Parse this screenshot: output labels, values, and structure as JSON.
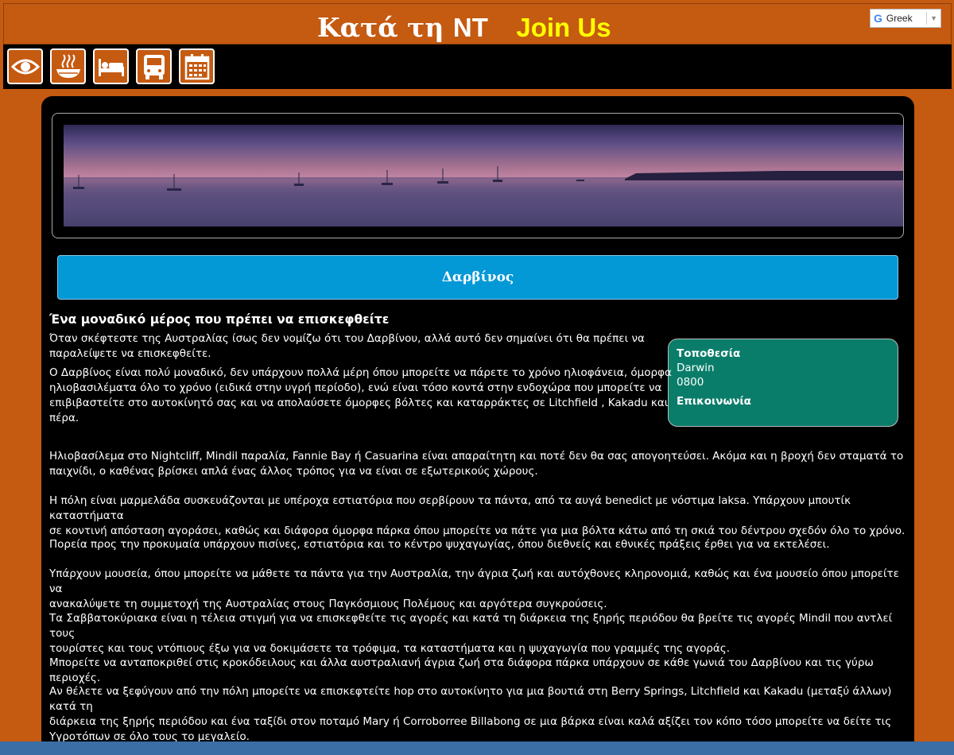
{
  "header": {
    "title_greek": "Κατά τη",
    "title_nt": "NT",
    "join_label": "Join Us"
  },
  "translate_widget": {
    "brand": "G",
    "language": "Greek",
    "arrow": "▼"
  },
  "nav_icons": [
    "eye-icon",
    "food-icon",
    "bed-icon",
    "bus-icon",
    "calendar-icon"
  ],
  "colors": {
    "header_bg": "#c55a11",
    "content_bg": "#000000",
    "city_bar": "#0398d6",
    "info_box": "#0a7d6a",
    "join_text": "#ffff00"
  },
  "page": {
    "city": "Δαρβίνος",
    "heading": "Ένα μοναδικό μέρος που πρέπει να επισκεφθείτε",
    "info": {
      "location_label": "Τοποθεσία",
      "location_city": "Darwin",
      "location_code": "0800",
      "contact_label": "Επικοινωνία"
    },
    "paragraphs": [
      [
        "Όταν σκέφτεστε της Αυστραλίας ίσως δεν νομίζω ότι του Δαρβίνου, αλλά αυτό δεν σημαίνει ότι θα πρέπει να",
        "παραλείψετε να επισκεφθείτε."
      ],
      [
        "Ο Δαρβίνος είναι πολύ μοναδικό, δεν υπάρχουν πολλά μέρη όπου μπορείτε να πάρετε το χρόνο ηλιοφάνεια, όμορφα",
        "ηλιοβασιλέματα όλο το χρόνο (ειδικά στην υγρή περίοδο), ενώ είναι τόσο κοντά στην ενδοχώρα που μπορείτε να",
        "επιβιβαστείτε στο αυτοκίνητό σας και να απολαύσετε όμορφες βόλτες και καταρράκτες σε Litchfield , Kakadu και",
        "πέρα."
      ],
      [
        "Ηλιοβασίλεμα στο Nightcliff, Mindil παραλία, Fannie Bay ή Casuarina είναι απαραίτητη και ποτέ δεν θα σας απογοητεύσει. Ακόμα και η βροχή δεν σταματά το",
        "παιχνίδι, ο καθένας βρίσκει απλά ένας άλλος τρόπος για να είναι σε εξωτερικούς χώρους."
      ],
      [
        "Η πόλη είναι μαρμελάδα συσκευάζονται με υπέροχα εστιατόρια που σερβίρουν τα πάντα, από τα αυγά benedict με νόστιμα laksa. Υπάρχουν μπουτίκ καταστήματα",
        "σε κοντινή απόσταση αγοράσει, καθώς και διάφορα όμορφα πάρκα όπου μπορείτε να πάτε για μια βόλτα κάτω από τη σκιά του δέντρου σχεδόν όλο το χρόνο."
      ],
      [
        "Πορεία προς την προκυμαία υπάρχουν πισίνες, εστιατόρια και το κέντρο ψυχαγωγίας, όπου διεθνείς και εθνικές πράξεις έρθει για να εκτελέσει."
      ],
      [
        "Υπάρχουν μουσεία, όπου μπορείτε να μάθετε τα πάντα για την Αυστραλία, την άγρια ζωή και αυτόχθονες κληρονομιά, καθώς και ένα μουσείο όπου μπορείτε να",
        "ανακαλύψετε τη συμμετοχή της Αυστραλίας στους Παγκόσμιους Πολέμους και αργότερα συγκρούσεις."
      ],
      [
        "Τα Σαββατοκύριακα είναι η τέλεια στιγμή για να επισκεφθείτε τις αγορές και κατά τη διάρκεια της ξηρής περιόδου θα βρείτε τις αγορές Mindil που αντλεί τους",
        "τουρίστες και τους ντόπιους έξω για να δοκιμάσετε τα τρόφιμα, τα καταστήματα και η ψυχαγωγία που γραμμές της αγοράς."
      ],
      [
        "Μπορείτε να ανταποκριθεί στις κροκόδειλους και άλλα αυστραλιανή άγρια ζωή στα διάφορα πάρκα υπάρχουν σε κάθε γωνιά του Δαρβίνου και τις γύρω περιοχές."
      ],
      [
        "Αν θέλετε να ξεφύγουν από την πόλη μπορείτε να επισκεφτείτε hop στο αυτοκίνητο για μια βουτιά στη Berry Springs, Litchfield και Kakadu (μεταξύ άλλων) κατά τη",
        "διάρκεια της ξηρής περιόδου και ένα ταξίδι στον ποταμό Mary ή Corroborree Billabong σε μια βάρκα είναι καλά αξίζει τον κόπο τόσο μπορείτε να δείτε τις",
        "Υγροτόπων σε όλο τους το μεγαλείο."
      ]
    ]
  }
}
